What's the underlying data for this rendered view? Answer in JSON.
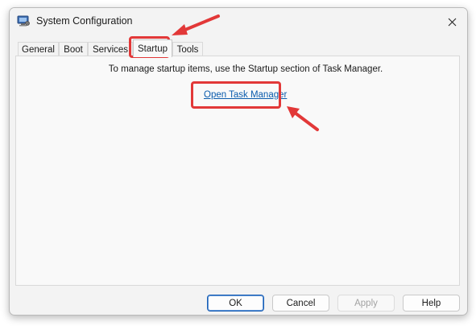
{
  "window": {
    "title": "System Configuration",
    "close_glyph": "✕"
  },
  "tabs": [
    {
      "label": "General",
      "active": false
    },
    {
      "label": "Boot",
      "active": false
    },
    {
      "label": "Services",
      "active": false
    },
    {
      "label": "Startup",
      "active": true
    },
    {
      "label": "Tools",
      "active": false
    }
  ],
  "startup": {
    "message": "To manage startup items, use the Startup section of Task Manager.",
    "link_label": "Open Task Manager"
  },
  "buttons": {
    "ok": "OK",
    "cancel": "Cancel",
    "apply": "Apply",
    "help": "Help"
  },
  "icons": {
    "app": "system-configuration-icon",
    "close": "close-icon"
  },
  "colors": {
    "annotation": "#e23838",
    "link": "#0b5cad",
    "default_button_border": "#1a5fb4"
  }
}
